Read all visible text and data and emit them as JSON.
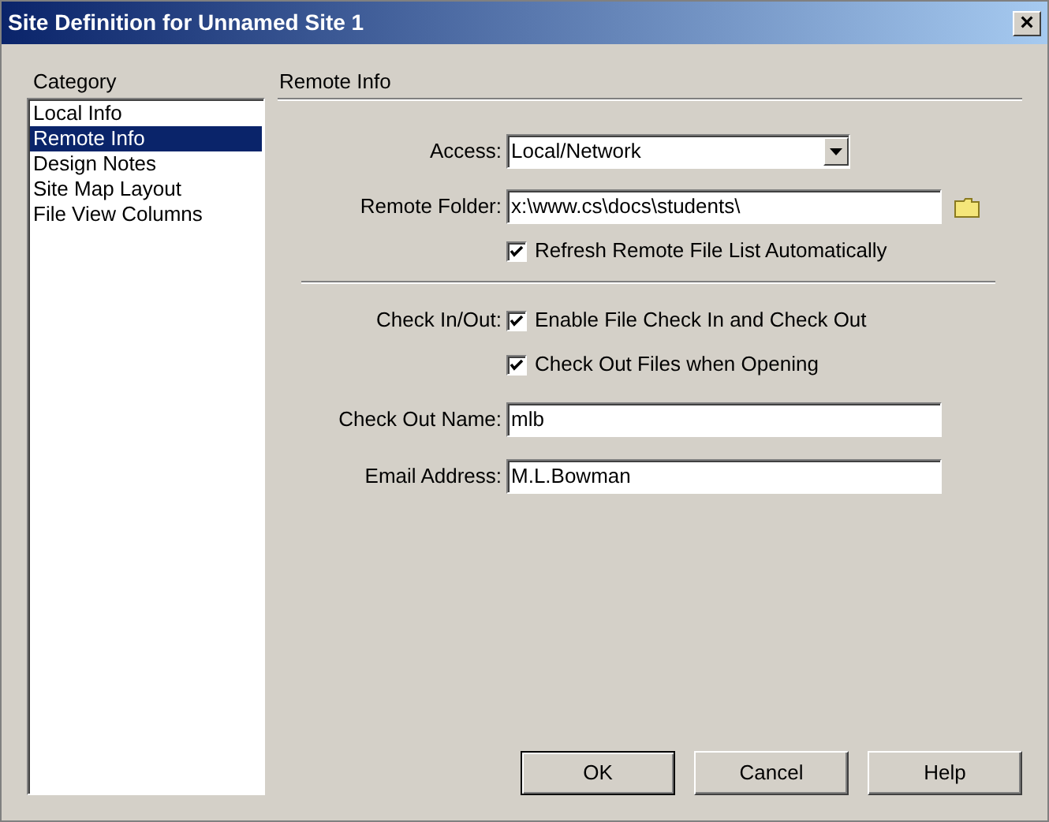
{
  "window": {
    "title": "Site Definition for Unnamed Site 1",
    "close": "×"
  },
  "sidebar": {
    "heading": "Category",
    "items": [
      {
        "label": "Local Info",
        "selected": false
      },
      {
        "label": "Remote Info",
        "selected": true
      },
      {
        "label": "Design Notes",
        "selected": false
      },
      {
        "label": "Site Map Layout",
        "selected": false
      },
      {
        "label": "File View Columns",
        "selected": false
      }
    ]
  },
  "panel": {
    "heading": "Remote Info",
    "access": {
      "label": "Access:",
      "value": "Local/Network"
    },
    "remote_folder": {
      "label": "Remote Folder:",
      "value": "x:\\www.cs\\docs\\students\\"
    },
    "refresh": {
      "label": "Refresh Remote File List Automatically",
      "checked": true
    },
    "check_in_out": {
      "label": "Check In/Out:",
      "options": [
        {
          "label": "Enable File Check In and Check Out",
          "checked": true
        },
        {
          "label": "Check Out Files when Opening",
          "checked": true
        }
      ]
    },
    "check_out_name": {
      "label": "Check Out Name:",
      "value": "mlb"
    },
    "email": {
      "label": "Email Address:",
      "value": "M.L.Bowman"
    }
  },
  "buttons": [
    {
      "label": "OK",
      "default": true
    },
    {
      "label": "Cancel",
      "default": false
    },
    {
      "label": "Help",
      "default": false
    }
  ]
}
